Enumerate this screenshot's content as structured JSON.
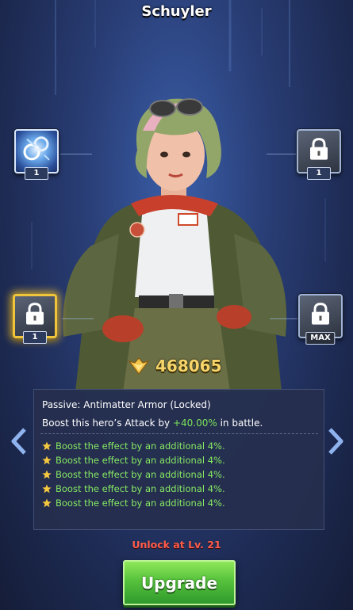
{
  "hero": {
    "name": "Schuyler"
  },
  "skill_slots": [
    {
      "position": "top-left",
      "state": "unlocked",
      "level_label": "1",
      "icon": "energy-gears-icon"
    },
    {
      "position": "top-right",
      "state": "locked",
      "level_label": "1",
      "icon": "lock-icon"
    },
    {
      "position": "bottom-left",
      "state": "locked-selected",
      "level_label": "1",
      "icon": "lock-icon"
    },
    {
      "position": "bottom-right",
      "state": "locked",
      "level_label": "MAX",
      "icon": "lock-icon"
    }
  ],
  "power": {
    "icon": "power-wings-icon",
    "value": "468065"
  },
  "skill_panel": {
    "title": "Passive: Antimatter Armor (Locked)",
    "desc_prefix": "Boost this hero’s Attack by",
    "desc_value": "+40.00%",
    "desc_suffix": "in battle.",
    "boosts": [
      "Boost the effect by an additional 4%.",
      "Boost the effect by an additional 4%.",
      "Boost the effect by an additional 4%.",
      "Boost the effect by an additional 4%.",
      "Boost the effect by an additional 4%."
    ]
  },
  "nav": {
    "prev_icon": "chevron-left-icon",
    "next_icon": "chevron-right-icon"
  },
  "unlock_text": "Unlock at Lv. 21",
  "upgrade_label": "Upgrade",
  "colors": {
    "accent_green": "#7be25a",
    "power_gold": "#f6d46a",
    "unlock_red": "#ff5d4a",
    "selected_gold": "#f1c53b"
  }
}
